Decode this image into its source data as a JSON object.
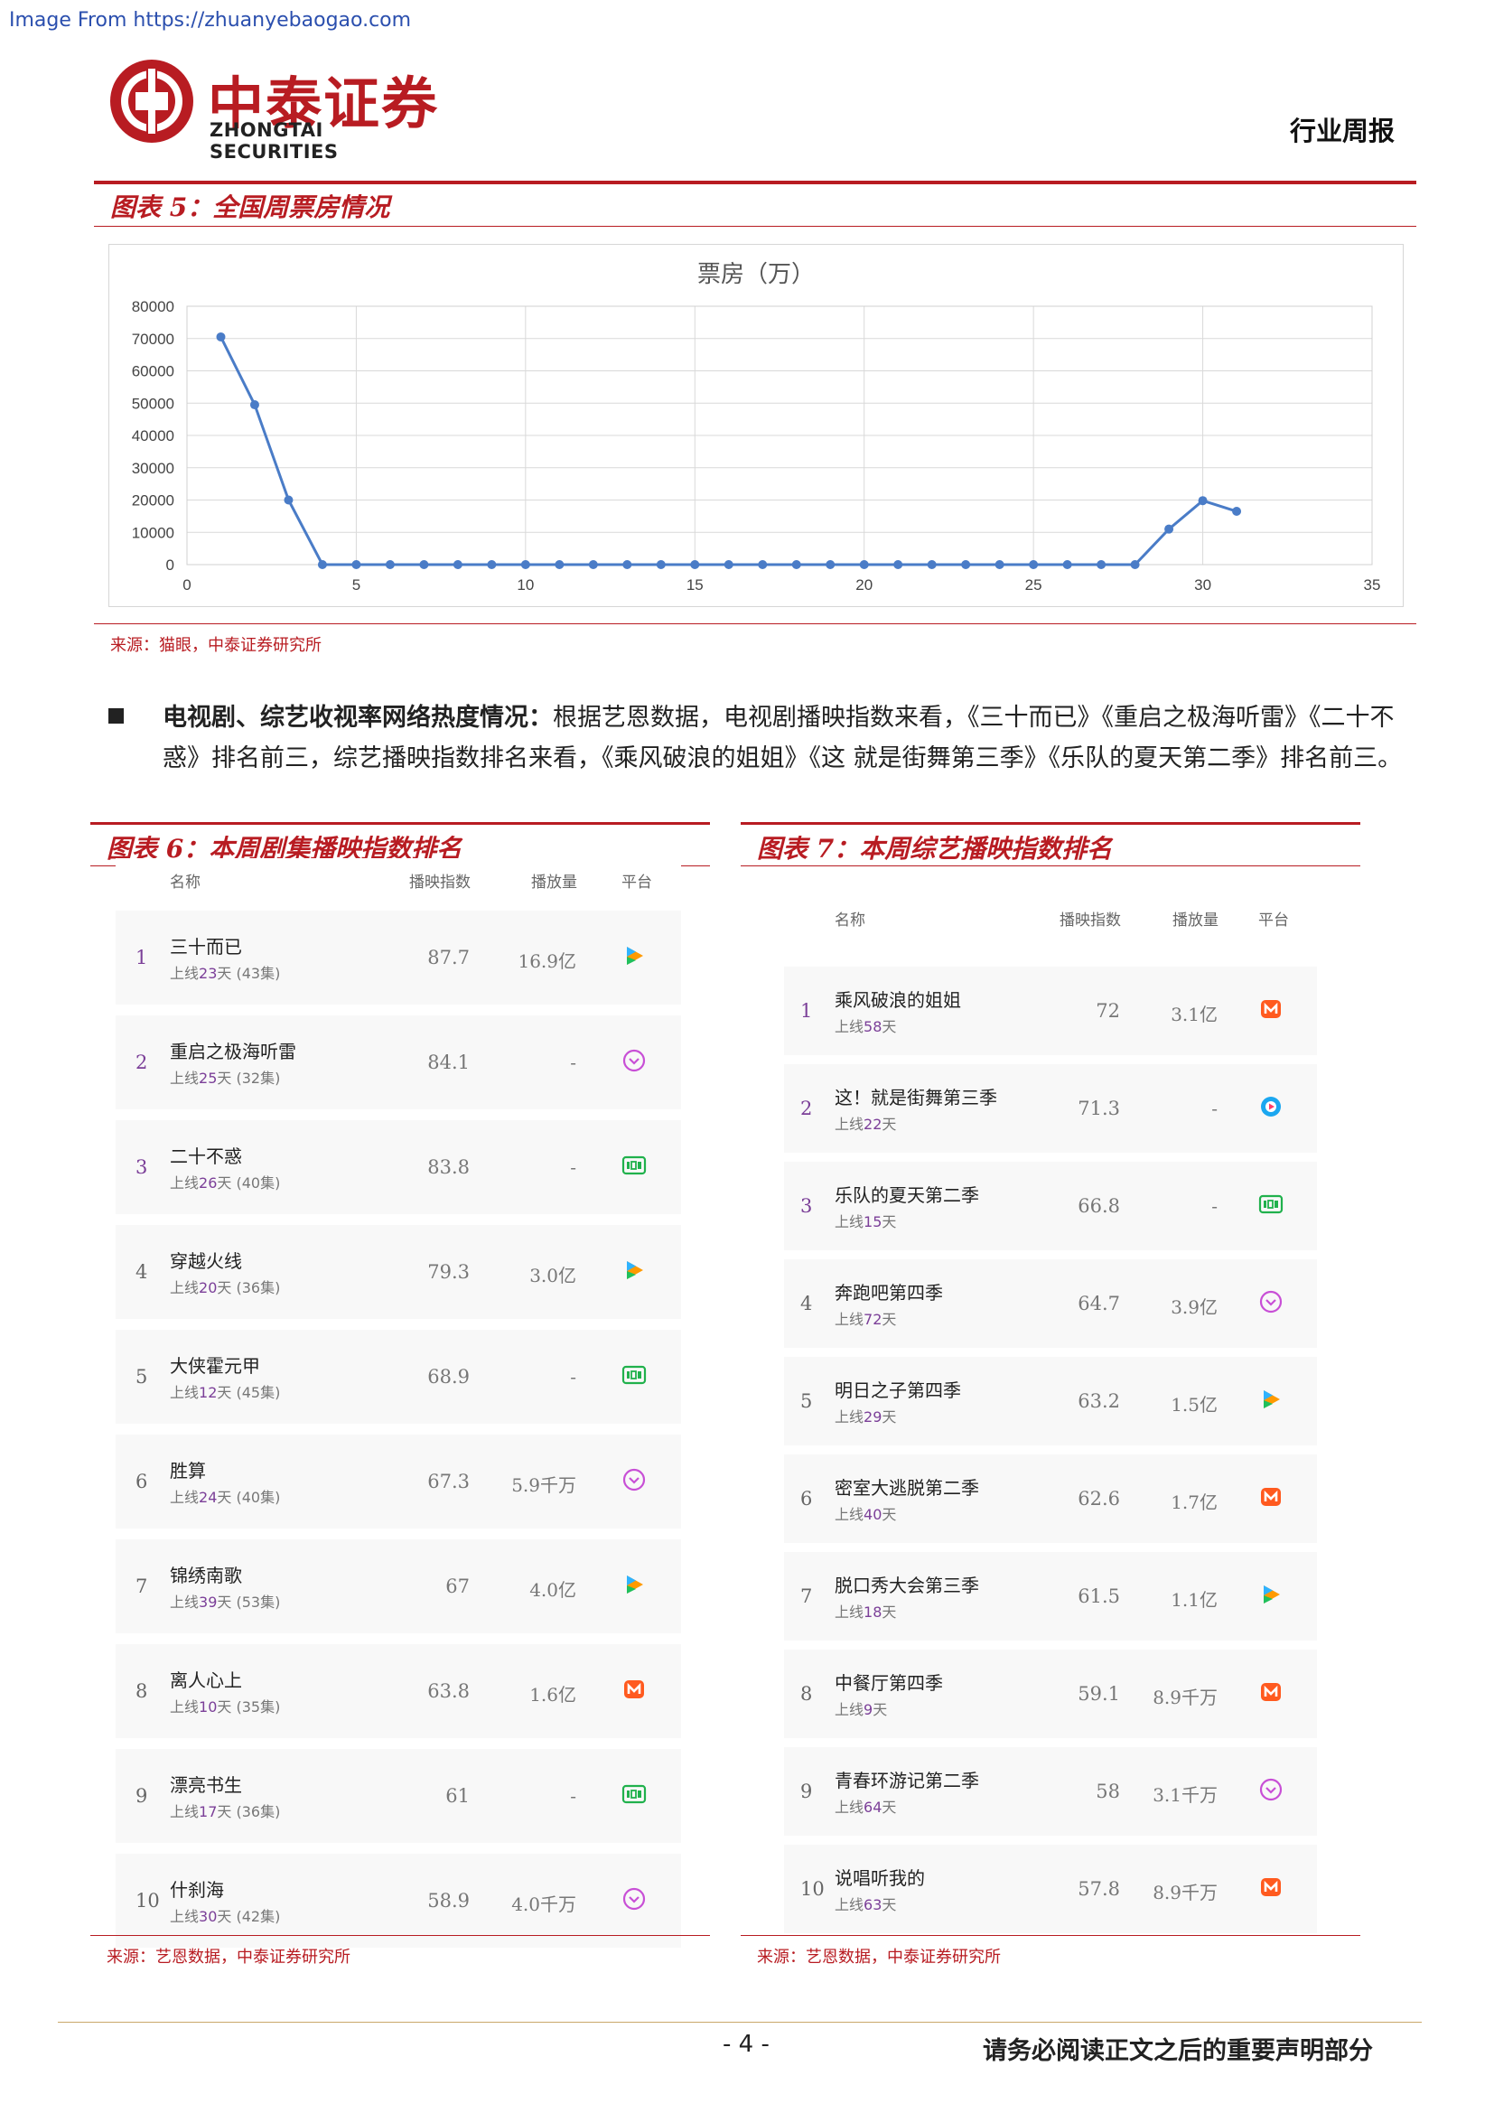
{
  "watermark": "Image From https://zhuanyebaogao.com",
  "brand": {
    "name_cn": "中泰证券",
    "name_en": "ZHONGTAI SECURITIES"
  },
  "header_tag": "行业周报",
  "figure5": {
    "title": "图表 5：全国周票房情况",
    "source": "来源：猫眼，中泰证券研究所"
  },
  "chart_data": {
    "type": "line",
    "title": "票房（万）",
    "xlabel": "",
    "ylabel": "",
    "xlim": [
      0,
      35
    ],
    "ylim": [
      0,
      80000
    ],
    "x_ticks": [
      0,
      5,
      10,
      15,
      20,
      25,
      30,
      35
    ],
    "y_ticks": [
      0,
      10000,
      20000,
      30000,
      40000,
      50000,
      60000,
      70000,
      80000
    ],
    "grid": true,
    "legend": "none",
    "color": "#4a7cc7",
    "series": [
      {
        "x": [
          1,
          2,
          3,
          4,
          5,
          6,
          7,
          8,
          9,
          10,
          11,
          12,
          13,
          14,
          15,
          16,
          17,
          18,
          19,
          20,
          21,
          22,
          23,
          24,
          25,
          26,
          27,
          28,
          29,
          30,
          31
        ],
        "values": [
          70500,
          49500,
          20000,
          0,
          0,
          0,
          0,
          0,
          0,
          0,
          0,
          0,
          0,
          0,
          0,
          0,
          0,
          0,
          0,
          0,
          0,
          0,
          0,
          0,
          0,
          0,
          0,
          0,
          11000,
          19800,
          16500
        ]
      }
    ]
  },
  "bullet": {
    "lead": "电视剧、综艺收视率网络热度情况：",
    "body": "根据艺恩数据，电视剧播映指数来看，《三十而已》《重启之极海听雷》《二十不惑》排名前三，综艺播映指数排名来看，《乘风破浪的姐姐》《这 就是街舞第三季》《乐队的夏天第二季》排名前三。"
  },
  "figure6": {
    "title": "图表 6：本周剧集播映指数排名",
    "source": "来源：艺恩数据，中泰证券研究所",
    "headers": {
      "name": "名称",
      "index": "播映指数",
      "volume": "播放量",
      "platform": "平台"
    },
    "rows": [
      {
        "rank": "1",
        "name": "三十而已",
        "pre": "上线",
        "days": "23",
        "post": "天 (43集)",
        "index": "87.7",
        "volume": "16.9亿",
        "platform": "tencent"
      },
      {
        "rank": "2",
        "name": "重启之极海听雷",
        "pre": "上线",
        "days": "25",
        "post": "天 (32集)",
        "index": "84.1",
        "volume": "-",
        "platform": "youku"
      },
      {
        "rank": "3",
        "name": "二十不惑",
        "pre": "上线",
        "days": "26",
        "post": "天 (40集)",
        "index": "83.8",
        "volume": "-",
        "platform": "iqiyi"
      },
      {
        "rank": "4",
        "name": "穿越火线",
        "pre": "上线",
        "days": "20",
        "post": "天 (36集)",
        "index": "79.3",
        "volume": "3.0亿",
        "platform": "tencent"
      },
      {
        "rank": "5",
        "name": "大侠霍元甲",
        "pre": "上线",
        "days": "12",
        "post": "天 (45集)",
        "index": "68.9",
        "volume": "-",
        "platform": "iqiyi"
      },
      {
        "rank": "6",
        "name": "胜算",
        "pre": "上线",
        "days": "24",
        "post": "天 (40集)",
        "index": "67.3",
        "volume": "5.9千万",
        "platform": "youku"
      },
      {
        "rank": "7",
        "name": "锦绣南歌",
        "pre": "上线",
        "days": "39",
        "post": "天 (53集)",
        "index": "67",
        "volume": "4.0亿",
        "platform": "tencent"
      },
      {
        "rank": "8",
        "name": "离人心上",
        "pre": "上线",
        "days": "10",
        "post": "天 (35集)",
        "index": "63.8",
        "volume": "1.6亿",
        "platform": "mango"
      },
      {
        "rank": "9",
        "name": "漂亮书生",
        "pre": "上线",
        "days": "17",
        "post": "天 (36集)",
        "index": "61",
        "volume": "-",
        "platform": "iqiyi"
      },
      {
        "rank": "10",
        "name": "什刹海",
        "pre": "上线",
        "days": "30",
        "post": "天 (42集)",
        "index": "58.9",
        "volume": "4.0千万",
        "platform": "youku"
      }
    ]
  },
  "figure7": {
    "title": "图表 7：本周综艺播映指数排名",
    "source": "来源：艺恩数据，中泰证券研究所",
    "headers": {
      "name": "名称",
      "index": "播映指数",
      "volume": "播放量",
      "platform": "平台"
    },
    "rows": [
      {
        "rank": "1",
        "name": "乘风破浪的姐姐",
        "pre": "上线",
        "days": "58",
        "post": "天",
        "index": "72",
        "volume": "3.1亿",
        "platform": "mango"
      },
      {
        "rank": "2",
        "name": "这！就是街舞第三季",
        "pre": "上线",
        "days": "22",
        "post": "天",
        "index": "71.3",
        "volume": "-",
        "platform": "youku-blue"
      },
      {
        "rank": "3",
        "name": "乐队的夏天第二季",
        "pre": "上线",
        "days": "15",
        "post": "天",
        "index": "66.8",
        "volume": "-",
        "platform": "iqiyi"
      },
      {
        "rank": "4",
        "name": "奔跑吧第四季",
        "pre": "上线",
        "days": "72",
        "post": "天",
        "index": "64.7",
        "volume": "3.9亿",
        "platform": "youku"
      },
      {
        "rank": "5",
        "name": "明日之子第四季",
        "pre": "上线",
        "days": "29",
        "post": "天",
        "index": "63.2",
        "volume": "1.5亿",
        "platform": "tencent"
      },
      {
        "rank": "6",
        "name": "密室大逃脱第二季",
        "pre": "上线",
        "days": "40",
        "post": "天",
        "index": "62.6",
        "volume": "1.7亿",
        "platform": "mango"
      },
      {
        "rank": "7",
        "name": "脱口秀大会第三季",
        "pre": "上线",
        "days": "18",
        "post": "天",
        "index": "61.5",
        "volume": "1.1亿",
        "platform": "tencent"
      },
      {
        "rank": "8",
        "name": "中餐厅第四季",
        "pre": "上线",
        "days": "9",
        "post": "天",
        "index": "59.1",
        "volume": "8.9千万",
        "platform": "mango"
      },
      {
        "rank": "9",
        "name": "青春环游记第二季",
        "pre": "上线",
        "days": "64",
        "post": "天",
        "index": "58",
        "volume": "3.1千万",
        "platform": "youku"
      },
      {
        "rank": "10",
        "name": "说唱听我的",
        "pre": "上线",
        "days": "63",
        "post": "天",
        "index": "57.8",
        "volume": "8.9千万",
        "platform": "mango"
      }
    ]
  },
  "footer": {
    "page": "- 4 -",
    "note": "请务必阅读正文之后的重要声明部分"
  }
}
